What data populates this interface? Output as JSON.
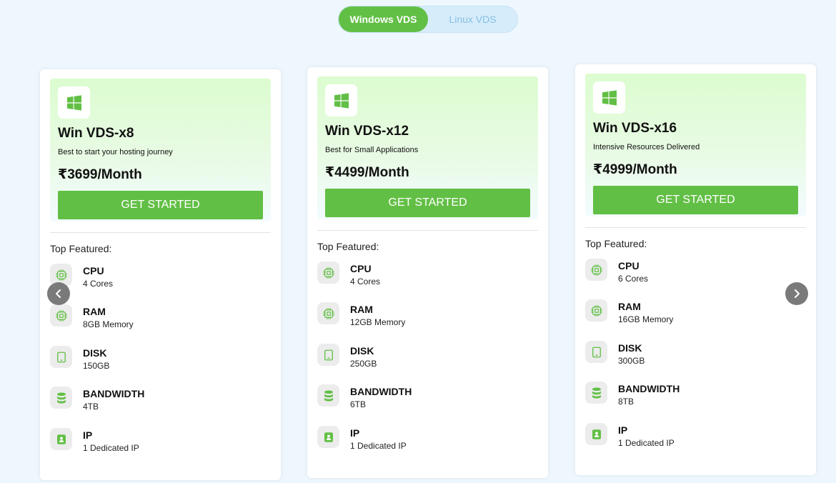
{
  "colors": {
    "accent": "#62bf45",
    "page_bg": "#eef7fd",
    "toggle_bg": "#d6ecfa",
    "icon_bg": "#ececec"
  },
  "toggle": {
    "windows_label": "Windows VDS",
    "linux_label": "Linux VDS",
    "selected": "Windows VDS"
  },
  "plans": [
    {
      "title": "Win VDS-x8",
      "subtitle": "Best to start your hosting journey",
      "price": "₹3699/Month",
      "cta": "GET STARTED",
      "features_title": "Top Featured:",
      "features": [
        {
          "icon": "cpu-icon",
          "name": "CPU",
          "value": "4 Cores"
        },
        {
          "icon": "cpu-icon",
          "name": "RAM",
          "value": "8GB Memory"
        },
        {
          "icon": "tablet-icon",
          "name": "DISK",
          "value": "150GB"
        },
        {
          "icon": "database-icon",
          "name": "BANDWIDTH",
          "value": "4TB"
        },
        {
          "icon": "id-badge-icon",
          "name": "IP",
          "value": "1 Dedicated IP"
        }
      ]
    },
    {
      "title": "Win VDS-x12",
      "subtitle": "Best for Small Applications",
      "price": "₹4499/Month",
      "cta": "GET STARTED",
      "features_title": "Top Featured:",
      "features": [
        {
          "icon": "cpu-icon",
          "name": "CPU",
          "value": "4 Cores"
        },
        {
          "icon": "cpu-icon",
          "name": "RAM",
          "value": "12GB Memory"
        },
        {
          "icon": "tablet-icon",
          "name": "DISK",
          "value": "250GB"
        },
        {
          "icon": "database-icon",
          "name": "BANDWIDTH",
          "value": "6TB"
        },
        {
          "icon": "id-badge-icon",
          "name": "IP",
          "value": "1 Dedicated IP"
        }
      ]
    },
    {
      "title": "Win VDS-x16",
      "subtitle": "Intensive Resources Delivered",
      "price": "₹4999/Month",
      "cta": "GET STARTED",
      "features_title": "Top Featured:",
      "features": [
        {
          "icon": "cpu-icon",
          "name": "CPU",
          "value": "6 Cores"
        },
        {
          "icon": "cpu-icon",
          "name": "RAM",
          "value": "16GB Memory"
        },
        {
          "icon": "tablet-icon",
          "name": "DISK",
          "value": "300GB"
        },
        {
          "icon": "database-icon",
          "name": "BANDWIDTH",
          "value": "8TB"
        },
        {
          "icon": "id-badge-icon",
          "name": "IP",
          "value": "1 Dedicated IP"
        }
      ]
    }
  ],
  "carousel": {
    "prev_icon": "chevron-left-icon",
    "next_icon": "chevron-right-icon"
  }
}
